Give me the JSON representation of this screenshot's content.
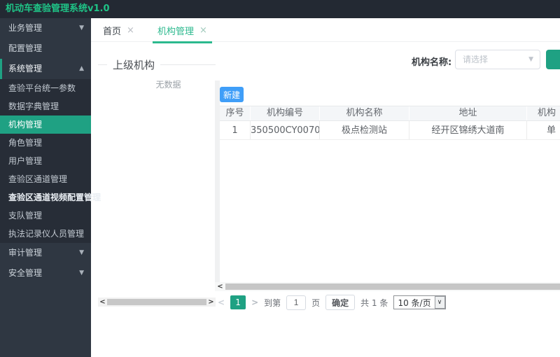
{
  "app": {
    "title": "机动车查验管理系统v1.0"
  },
  "icons": {
    "chevron_down": "▼",
    "chevron_up": "▲",
    "close": "×",
    "select_arrow": "▼",
    "scroll_left": "<",
    "scroll_right": ">",
    "native_select_arrow": "∨"
  },
  "sidebar": {
    "top_items": [
      {
        "label": "业务管理"
      },
      {
        "label": "配置管理"
      },
      {
        "label": "系统管理"
      }
    ],
    "submenu": [
      {
        "label": "查验平台统一参数"
      },
      {
        "label": "数据字典管理"
      },
      {
        "label": "机构管理"
      },
      {
        "label": "角色管理"
      },
      {
        "label": "用户管理"
      },
      {
        "label": "查验区通道管理"
      },
      {
        "label": "查验区通道视频配置管理"
      },
      {
        "label": "支队管理"
      },
      {
        "label": "执法记录仪人员管理"
      }
    ],
    "bottom_items": [
      {
        "label": "审计管理"
      },
      {
        "label": "安全管理"
      }
    ]
  },
  "tabs": {
    "items": [
      {
        "label": "首页"
      },
      {
        "label": "机构管理"
      }
    ]
  },
  "tree_panel": {
    "title": "上级机构",
    "empty_text": "无数据"
  },
  "filter": {
    "label": "机构名称:",
    "placeholder": "请选择",
    "search_button_label": ""
  },
  "toolbar": {
    "new_button": "新建"
  },
  "table": {
    "headers": [
      "序号",
      "机构编号",
      "机构名称",
      "地址",
      "机构"
    ],
    "rows": [
      {
        "seq": "1",
        "code": "350500CY0070",
        "name": "极点检测站",
        "address": "经开区锦绣大道南",
        "type": "单"
      }
    ]
  },
  "pagination": {
    "current_page": "1",
    "goto_label": "到第",
    "page_input": "1",
    "page_unit": "页",
    "confirm_label": "确定",
    "total_label": "共 1 条",
    "page_size_label": "10 条/页"
  },
  "colors": {
    "accent_teal": "#1fa183",
    "title_green": "#1fc487",
    "primary_button_blue": "#3f9ef8",
    "sidebar_bg": "#2f3742",
    "header_bg": "#232933"
  }
}
